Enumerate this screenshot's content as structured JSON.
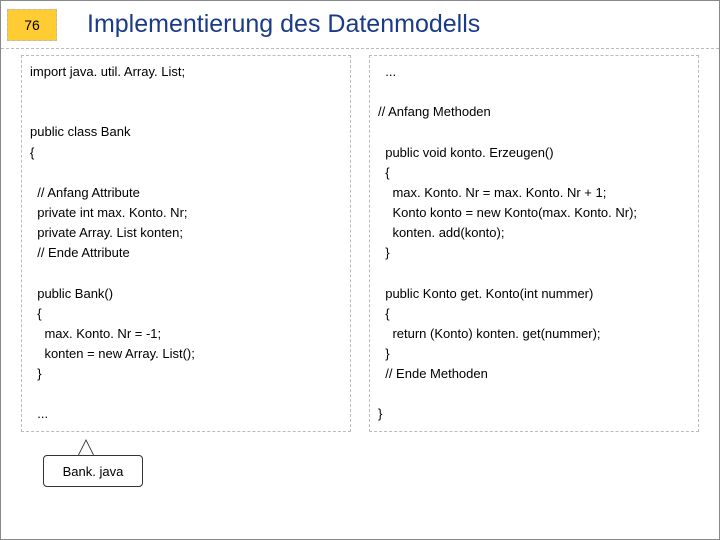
{
  "page_number": "76",
  "title": "Implementierung des Datenmodells",
  "left_code": "import java. util. Array. List;\n\n\npublic class Bank\n{\n\n  // Anfang Attribute\n  private int max. Konto. Nr;\n  private Array. List konten;\n  // Ende Attribute\n\n  public Bank()\n  {\n    max. Konto. Nr = -1;\n    konten = new Array. List();\n  }\n\n  ...",
  "right_code": "  ...\n\n// Anfang Methoden\n\n  public void konto. Erzeugen()\n  {\n    max. Konto. Nr = max. Konto. Nr + 1;\n    Konto konto = new Konto(max. Konto. Nr);\n    konten. add(konto);\n  }\n\n  public Konto get. Konto(int nummer)\n  {\n    return (Konto) konten. get(nummer);\n  }\n  // Ende Methoden\n\n}",
  "callout_label": "Bank. java"
}
